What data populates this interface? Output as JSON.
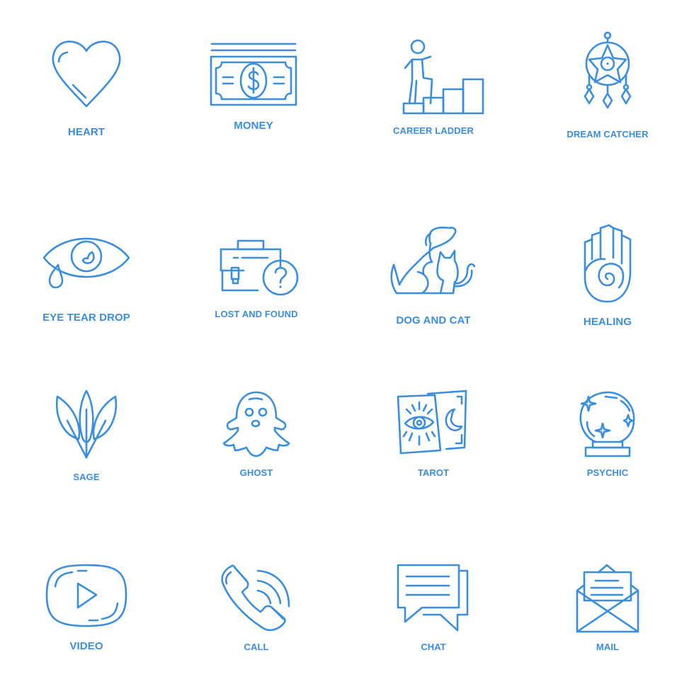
{
  "accent_color": "#3a8ee0",
  "icons": [
    {
      "label": "HEART",
      "icon": "heart-icon"
    },
    {
      "label": "MONEY",
      "icon": "money-icon"
    },
    {
      "label": "CAREER LADDER",
      "icon": "career-ladder-icon"
    },
    {
      "label": "DREAM CATCHER",
      "icon": "dream-catcher-icon"
    },
    {
      "label": "EYE TEAR DROP",
      "icon": "eye-tear-drop-icon"
    },
    {
      "label": "LOST AND FOUND",
      "icon": "lost-and-found-icon"
    },
    {
      "label": "DOG AND CAT",
      "icon": "dog-and-cat-icon"
    },
    {
      "label": "HEALING",
      "icon": "healing-icon"
    },
    {
      "label": "SAGE",
      "icon": "sage-icon"
    },
    {
      "label": "GHOST",
      "icon": "ghost-icon"
    },
    {
      "label": "TAROT",
      "icon": "tarot-icon"
    },
    {
      "label": "PSYCHIC",
      "icon": "psychic-icon"
    },
    {
      "label": "VIDEO",
      "icon": "video-icon"
    },
    {
      "label": "CALL",
      "icon": "call-icon"
    },
    {
      "label": "CHAT",
      "icon": "chat-icon"
    },
    {
      "label": "MAIL",
      "icon": "mail-icon"
    }
  ]
}
